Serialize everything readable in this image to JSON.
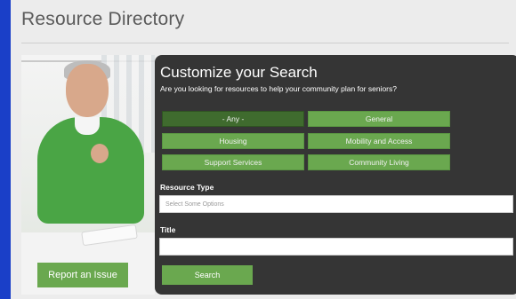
{
  "page": {
    "title": "Resource Directory"
  },
  "actions": {
    "report_issue": "Report an Issue"
  },
  "search": {
    "heading": "Customize your Search",
    "question": "Are you looking for resources to help your community plan for seniors?",
    "chips": [
      {
        "label": "- Any -",
        "selected": true
      },
      {
        "label": "General",
        "selected": false
      },
      {
        "label": "Housing",
        "selected": false
      },
      {
        "label": "Mobility and Access",
        "selected": false
      },
      {
        "label": "Support Services",
        "selected": false
      },
      {
        "label": "Community Living",
        "selected": false
      }
    ],
    "resource_type": {
      "label": "Resource Type",
      "placeholder": "Select Some Options"
    },
    "title_field": {
      "label": "Title",
      "value": ""
    },
    "submit_label": "Search"
  },
  "colors": {
    "accent_green": "#6aa84f",
    "selected_green": "#3f6b2e",
    "panel_dark": "#353535",
    "page_bg": "#ececec",
    "border_blue": "#1a3fc8"
  }
}
